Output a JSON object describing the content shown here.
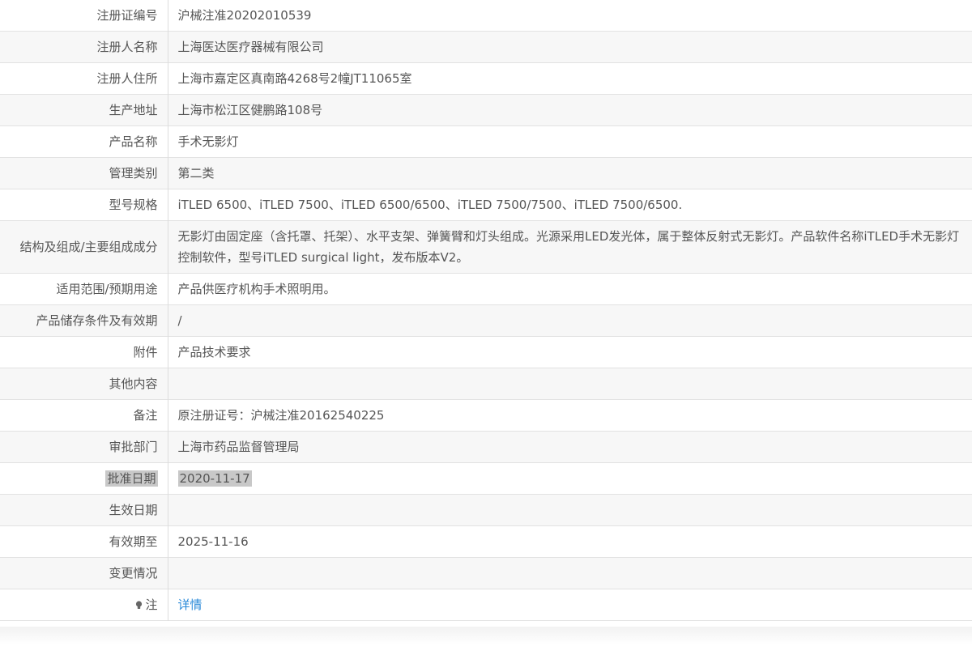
{
  "rows": [
    {
      "label": "注册证编号",
      "value": "沪械注准20202010539"
    },
    {
      "label": "注册人名称",
      "value": "上海医达医疗器械有限公司"
    },
    {
      "label": "注册人住所",
      "value": "上海市嘉定区真南路4268号2幢JT11065室"
    },
    {
      "label": "生产地址",
      "value": "上海市松江区健鹏路108号"
    },
    {
      "label": "产品名称",
      "value": "手术无影灯"
    },
    {
      "label": "管理类别",
      "value": "第二类"
    },
    {
      "label": "型号规格",
      "value": "iTLED 6500、iTLED 7500、iTLED 6500/6500、iTLED 7500/7500、iTLED 7500/6500."
    },
    {
      "label": "结构及组成/主要组成成分",
      "value": "无影灯由固定座（含托罩、托架）、水平支架、弹簧臂和灯头组成。光源采用LED发光体，属于整体反射式无影灯。产品软件名称iTLED手术无影灯控制软件，型号iTLED surgical light，发布版本V2。"
    },
    {
      "label": "适用范围/预期用途",
      "value": "产品供医疗机构手术照明用。"
    },
    {
      "label": "产品储存条件及有效期",
      "value": "/"
    },
    {
      "label": "附件",
      "value": "产品技术要求"
    },
    {
      "label": "其他内容",
      "value": ""
    },
    {
      "label": "备注",
      "value": "原注册证号：沪械注准20162540225"
    },
    {
      "label": "审批部门",
      "value": "上海市药品监督管理局"
    },
    {
      "label": "批准日期",
      "value": "2020-11-17"
    },
    {
      "label": "生效日期",
      "value": ""
    },
    {
      "label": "有效期至",
      "value": "2025-11-16"
    },
    {
      "label": "变更情况",
      "value": ""
    },
    {
      "label": "注",
      "value": "详情",
      "icon": "lightbulb-icon"
    }
  ],
  "colors": {
    "link": "#2a8ad8",
    "highlight": "#c8c8c8",
    "stripe": "#f7f7f7",
    "border": "#e2e2e2"
  }
}
